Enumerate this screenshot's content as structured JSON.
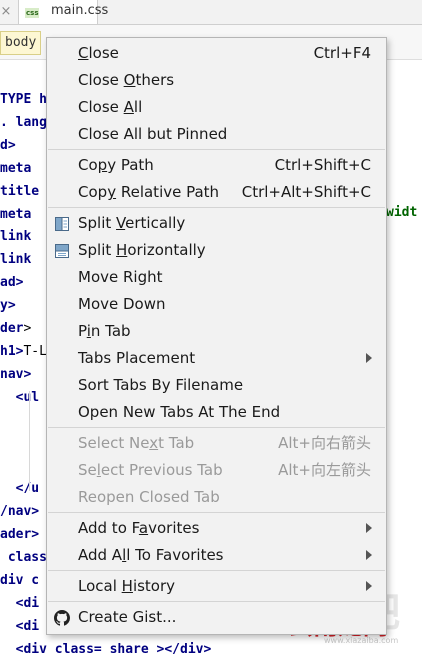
{
  "editor": {
    "tab_close_glyph": "×",
    "tab_badge": "css",
    "tab_name": "main.css",
    "breadcrumb": "body",
    "code_lines": [
      {
        "text": "TYPE h",
        "rest": ""
      },
      {
        "text": ". lang",
        "rest": ""
      },
      {
        "text": "d>",
        "rest": ""
      },
      {
        "text": "meta ",
        "rest": ""
      },
      {
        "text": "title",
        "rest": ""
      },
      {
        "text": "meta ",
        "rest": ""
      },
      {
        "text": "link ",
        "rest": ""
      },
      {
        "text": "link ",
        "rest": ""
      },
      {
        "text": "ad>",
        "rest": ""
      },
      {
        "text": "y>",
        "rest": ""
      },
      {
        "text": "der",
        "rest": ">"
      },
      {
        "text": "h1>",
        "rest": "T-L"
      },
      {
        "text": "nav>",
        "rest": ""
      },
      {
        "text": "  <ul",
        "rest": ""
      },
      {
        "text": "",
        "rest": ""
      },
      {
        "text": "",
        "rest": ""
      },
      {
        "text": "",
        "rest": ""
      },
      {
        "text": "  </u",
        "rest": ""
      },
      {
        "text": "/nav>",
        "rest": ""
      },
      {
        "text": "ader>",
        "rest": ""
      },
      {
        "text": " class",
        "rest": ""
      },
      {
        "text": "div c",
        "rest": ""
      },
      {
        "text": "  <di",
        "rest": ""
      },
      {
        "text": "  <di",
        "rest": ""
      },
      {
        "text": "  <div class= share ></div>",
        "rest": ""
      }
    ],
    "code_right_fragment": "widt"
  },
  "watermark": {
    "ghost": "下载吧",
    "brand": "云南龙网",
    "domain": "www.xiazaiba.com"
  },
  "menu": {
    "groups": [
      [
        {
          "label_parts": [
            "",
            "C",
            "lose"
          ],
          "shortcut": "Ctrl+F4",
          "enabled": true
        },
        {
          "label_parts": [
            "Close ",
            "O",
            "thers"
          ],
          "shortcut": "",
          "enabled": true
        },
        {
          "label_parts": [
            "Close ",
            "A",
            "ll"
          ],
          "shortcut": "",
          "enabled": true
        },
        {
          "label_parts": [
            "Close All but Pinned",
            "",
            ""
          ],
          "shortcut": "",
          "enabled": true
        }
      ],
      [
        {
          "label_parts": [
            "Co",
            "p",
            "y Path"
          ],
          "shortcut": "Ctrl+Shift+C",
          "enabled": true
        },
        {
          "label_parts": [
            "Cop",
            "y",
            " Relative Path"
          ],
          "shortcut": "Ctrl+Alt+Shift+C",
          "enabled": true
        }
      ],
      [
        {
          "label_parts": [
            "Split ",
            "V",
            "ertically"
          ],
          "shortcut": "",
          "enabled": true,
          "icon": "split-vertical-icon"
        },
        {
          "label_parts": [
            "Split ",
            "H",
            "orizontally"
          ],
          "shortcut": "",
          "enabled": true,
          "icon": "split-horizontal-icon"
        },
        {
          "label_parts": [
            "Move Right",
            "",
            ""
          ],
          "shortcut": "",
          "enabled": true
        },
        {
          "label_parts": [
            "Move Down",
            "",
            ""
          ],
          "shortcut": "",
          "enabled": true
        },
        {
          "label_parts": [
            "P",
            "i",
            "n Tab"
          ],
          "shortcut": "",
          "enabled": true
        },
        {
          "label_parts": [
            "Tabs Placement",
            "",
            ""
          ],
          "shortcut": "",
          "enabled": true,
          "submenu": true
        },
        {
          "label_parts": [
            "Sort Tabs By Filename",
            "",
            ""
          ],
          "shortcut": "",
          "enabled": true
        },
        {
          "label_parts": [
            "Open New Tabs At The End",
            "",
            ""
          ],
          "shortcut": "",
          "enabled": true
        }
      ],
      [
        {
          "label_parts": [
            "Select Ne",
            "x",
            "t Tab"
          ],
          "shortcut": "Alt+向右箭头",
          "enabled": false
        },
        {
          "label_parts": [
            "Se",
            "l",
            "ect Previous Tab"
          ],
          "shortcut": "Alt+向左箭头",
          "enabled": false
        },
        {
          "label_parts": [
            "Reopen Closed Tab",
            "",
            ""
          ],
          "shortcut": "",
          "enabled": false
        }
      ],
      [
        {
          "label_parts": [
            "Add to F",
            "a",
            "vorites"
          ],
          "shortcut": "",
          "enabled": true,
          "submenu": true
        },
        {
          "label_parts": [
            "Add A",
            "l",
            "l To Favorites"
          ],
          "shortcut": "",
          "enabled": true,
          "submenu": true
        }
      ],
      [
        {
          "label_parts": [
            "Local ",
            "H",
            "istory"
          ],
          "shortcut": "",
          "enabled": true,
          "submenu": true
        }
      ],
      [
        {
          "label_parts": [
            "Create Gist...",
            "",
            ""
          ],
          "shortcut": "",
          "enabled": true,
          "icon": "github-icon"
        }
      ]
    ]
  }
}
